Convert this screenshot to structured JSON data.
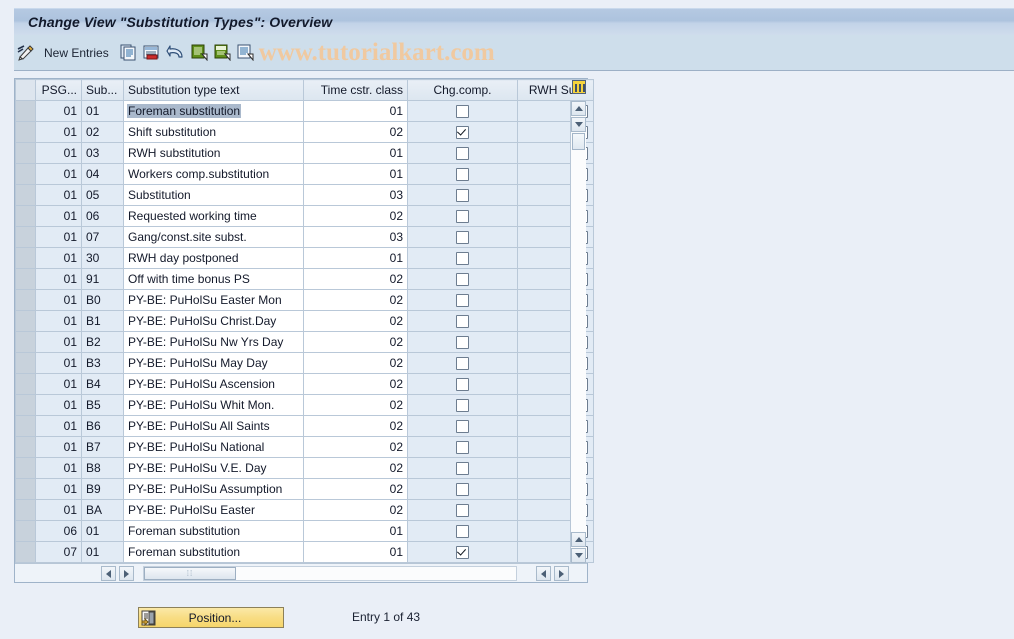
{
  "window": {
    "title": "Change View \"Substitution Types\": Overview"
  },
  "toolbar": {
    "edit_icon": "pencil-icon",
    "new_entries_label": "New Entries",
    "icons": [
      {
        "name": "copy-icon"
      },
      {
        "name": "delete-row-icon"
      },
      {
        "name": "undo-icon"
      },
      {
        "name": "select-all-icon"
      },
      {
        "name": "deselect-all-icon"
      },
      {
        "name": "details-icon"
      }
    ],
    "watermark": "www.tutorialkart.com"
  },
  "table": {
    "columns": [
      {
        "key": "psg",
        "label": "PSG..."
      },
      {
        "key": "sub",
        "label": "Sub..."
      },
      {
        "key": "text",
        "label": "Substitution type text"
      },
      {
        "key": "time",
        "label": "Time cstr. class"
      },
      {
        "key": "chg",
        "label": "Chg.comp."
      },
      {
        "key": "rwh",
        "label": "RWH Sub"
      }
    ],
    "config_icon": "table-settings-icon",
    "rows": [
      {
        "psg": "01",
        "sub": "01",
        "text": "Foreman substitution",
        "time": "01",
        "chg": false,
        "rwh": false,
        "selected": true
      },
      {
        "psg": "01",
        "sub": "02",
        "text": "Shift substitution",
        "time": "02",
        "chg": true,
        "rwh": false,
        "selected": false
      },
      {
        "psg": "01",
        "sub": "03",
        "text": "RWH substitution",
        "time": "01",
        "chg": false,
        "rwh": false,
        "selected": false
      },
      {
        "psg": "01",
        "sub": "04",
        "text": "Workers comp.substitution",
        "time": "01",
        "chg": false,
        "rwh": false,
        "selected": false
      },
      {
        "psg": "01",
        "sub": "05",
        "text": "Substitution",
        "time": "03",
        "chg": false,
        "rwh": false,
        "selected": false
      },
      {
        "psg": "01",
        "sub": "06",
        "text": "Requested working time",
        "time": "02",
        "chg": false,
        "rwh": false,
        "selected": false
      },
      {
        "psg": "01",
        "sub": "07",
        "text": "Gang/const.site subst.",
        "time": "03",
        "chg": false,
        "rwh": false,
        "selected": false
      },
      {
        "psg": "01",
        "sub": "30",
        "text": "RWH day postponed",
        "time": "01",
        "chg": false,
        "rwh": false,
        "selected": false
      },
      {
        "psg": "01",
        "sub": "91",
        "text": "Off with time bonus PS",
        "time": "02",
        "chg": false,
        "rwh": false,
        "selected": false
      },
      {
        "psg": "01",
        "sub": "B0",
        "text": "PY-BE: PuHolSu Easter Mon",
        "time": "02",
        "chg": false,
        "rwh": false,
        "selected": false
      },
      {
        "psg": "01",
        "sub": "B1",
        "text": "PY-BE: PuHolSu Christ.Day",
        "time": "02",
        "chg": false,
        "rwh": false,
        "selected": false
      },
      {
        "psg": "01",
        "sub": "B2",
        "text": "PY-BE: PuHolSu Nw Yrs Day",
        "time": "02",
        "chg": false,
        "rwh": false,
        "selected": false
      },
      {
        "psg": "01",
        "sub": "B3",
        "text": "PY-BE: PuHolSu May Day",
        "time": "02",
        "chg": false,
        "rwh": false,
        "selected": false
      },
      {
        "psg": "01",
        "sub": "B4",
        "text": "PY-BE: PuHolSu Ascension",
        "time": "02",
        "chg": false,
        "rwh": false,
        "selected": false
      },
      {
        "psg": "01",
        "sub": "B5",
        "text": "PY-BE: PuHolSu Whit Mon.",
        "time": "02",
        "chg": false,
        "rwh": false,
        "selected": false
      },
      {
        "psg": "01",
        "sub": "B6",
        "text": "PY-BE: PuHolSu All Saints",
        "time": "02",
        "chg": false,
        "rwh": false,
        "selected": false
      },
      {
        "psg": "01",
        "sub": "B7",
        "text": "PY-BE: PuHolSu National",
        "time": "02",
        "chg": false,
        "rwh": false,
        "selected": false
      },
      {
        "psg": "01",
        "sub": "B8",
        "text": "PY-BE: PuHolSu V.E. Day",
        "time": "02",
        "chg": false,
        "rwh": false,
        "selected": false
      },
      {
        "psg": "01",
        "sub": "B9",
        "text": "PY-BE: PuHolSu Assumption",
        "time": "02",
        "chg": false,
        "rwh": false,
        "selected": false
      },
      {
        "psg": "01",
        "sub": "BA",
        "text": "PY-BE: PuHolSu Easter",
        "time": "02",
        "chg": false,
        "rwh": false,
        "selected": false
      },
      {
        "psg": "06",
        "sub": "01",
        "text": "Foreman substitution",
        "time": "01",
        "chg": false,
        "rwh": false,
        "selected": false
      },
      {
        "psg": "07",
        "sub": "01",
        "text": "Foreman substitution",
        "time": "01",
        "chg": true,
        "rwh": false,
        "selected": false
      }
    ]
  },
  "footer": {
    "position_label": "Position...",
    "position_icon": "position-icon",
    "entry_info": "Entry 1 of 43"
  },
  "colors": {
    "title_bar": "#b0c4dd",
    "toolbar": "#cedeeb",
    "page_bg": "#eaeff7",
    "row_blue": "#e2ebf5",
    "selection": "#aab9cc",
    "button_yellow": "#f8dd84",
    "watermark": "#f0c9a0"
  }
}
